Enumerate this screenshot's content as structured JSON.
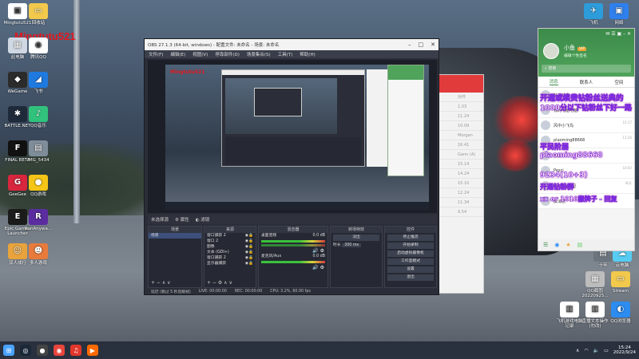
{
  "desktop": {
    "watermark": "Mingtutu521",
    "icons": [
      {
        "label": "Mingtutu521",
        "glyph": "▣",
        "color": "#ffffff"
      },
      {
        "label": "回收站",
        "glyph": "▭",
        "color": "#f2c94c"
      },
      {
        "label": "此电脑",
        "glyph": "▦",
        "color": "#cfd8e3"
      },
      {
        "label": "腾讯QQ",
        "glyph": "◉",
        "color": "#ffffff"
      },
      {
        "label": "WeGame",
        "glyph": "◆",
        "color": "#2b2b2b"
      },
      {
        "label": "飞书",
        "glyph": "◢",
        "color": "#1f7ae0"
      },
      {
        "label": "BATTLE.NET",
        "glyph": "✱",
        "color": "#1e2a3a"
      },
      {
        "label": "QQ音乐",
        "glyph": "♪",
        "color": "#31c27c"
      },
      {
        "label": "FINAL BETA",
        "glyph": "F",
        "color": "#111111"
      },
      {
        "label": "IMG_5434",
        "glyph": "▤",
        "color": "#7f8c99"
      },
      {
        "label": "GeeGee",
        "glyph": "G",
        "color": "#d7263d"
      },
      {
        "label": "QQ游戏",
        "glyph": "●",
        "color": "#f5c518"
      },
      {
        "label": "Epic Games Launcher",
        "glyph": "E",
        "color": "#1b1b1b"
      },
      {
        "label": "RunAnywa...",
        "glyph": "R",
        "color": "#5b2ca0"
      },
      {
        "label": "双人成行",
        "glyph": "☺",
        "color": "#e8a33c"
      },
      {
        "label": "多人游戏",
        "glyph": "☻",
        "color": "#e87b3c"
      }
    ],
    "right_icons": [
      {
        "label": "飞机",
        "glyph": "✈",
        "color": "#2d9cdb"
      },
      {
        "label": "网络",
        "glyph": "▣",
        "color": "#2f80ed"
      },
      {
        "label": "十年",
        "glyph": "▤",
        "color": "#6c757d"
      },
      {
        "label": "云电脑",
        "glyph": "☁",
        "color": "#56ccf2"
      },
      {
        "label": "QQ截图 20220925...",
        "glyph": "▦",
        "color": "#bdbdbd"
      },
      {
        "label": "Stream",
        "glyph": "▭",
        "color": "#f2c94c"
      },
      {
        "label": "飞机游戏电脑记录",
        "glyph": "▥",
        "color": "#ffffff"
      },
      {
        "label": "直播文本操作(勿改)",
        "glyph": "▥",
        "color": "#ffffff"
      },
      {
        "label": "QQ浏览器",
        "glyph": "◐",
        "color": "#2d8cf0"
      }
    ]
  },
  "obs": {
    "title": "OBS 27.1.3 (64-bit, windows) - 配置文件: 未命名 - 场景: 未命名",
    "menu": [
      "文件(F)",
      "编辑(E)",
      "视图(V)",
      "停靠部件(D)",
      "场景集合(S)",
      "工具(T)",
      "帮助(H)"
    ],
    "preview_label": "Mingtutu521",
    "scene_bar": {
      "label": "未选择源",
      "props": "属性",
      "filters": "滤镜"
    },
    "docks": {
      "scenes": {
        "title": "场景",
        "items": [
          "场景"
        ]
      },
      "sources": {
        "title": "来源",
        "items": [
          "窗口捕获 2",
          "窗口 2",
          "图像",
          "文本 (GDI+)",
          "窗口捕获 2",
          "显示器捕获"
        ]
      },
      "mixer": {
        "title": "混音器",
        "channels": [
          {
            "name": "桌面音频",
            "db": "0.0 dB"
          },
          {
            "name": "麦克风/Aux",
            "db": "0.0 dB"
          }
        ]
      },
      "transitions": {
        "title": "转场特效",
        "mode": "淡出",
        "duration_label": "时长",
        "duration": "300 ms"
      },
      "controls": {
        "title": "控件",
        "buttons": [
          "停止推流",
          "开始录制",
          "启动虚拟摄像机",
          "工作室模式",
          "设置",
          "退出"
        ]
      }
    },
    "status": {
      "live": "LIVE: 00:00:00",
      "rec": "REC: 00:00:00",
      "cpu": "CPU: 3.2%, 60.00 fps",
      "stream": "延迟 (跳过 5 秒后跳帧)"
    }
  },
  "redwin": {
    "rows": [
      "对件",
      "1.03",
      "11.24",
      "10.09",
      "Morgan",
      "16.41",
      "Gann (A)",
      "15.14",
      "14.24",
      "15.10",
      "12.24",
      "11.34",
      "9.54"
    ]
  },
  "qq": {
    "name": "小鱼",
    "vip": "VIP",
    "signature": "编辑个性签名",
    "search": "搜索",
    "tabs": [
      "消息",
      "联系人",
      "空间"
    ],
    "items": [
      {
        "name": "好友动态",
        "sub": "",
        "time": ""
      },
      {
        "name": "我的电脑电脑",
        "sub": "",
        "time": "15:22"
      },
      {
        "name": "风中小飞鸟",
        "sub": "",
        "time": "15:17"
      },
      {
        "name": "plaoming88668",
        "sub": "",
        "time": "11:26"
      },
      {
        "name": "群聊",
        "sub": "",
        "time": ""
      },
      {
        "name": "Pesci",
        "sub": "",
        "time": "10:02"
      },
      {
        "name": "Rooney托尼",
        "sub": "",
        "time": "昨天"
      },
      {
        "name": "群消息",
        "sub": "",
        "time": ""
      }
    ],
    "overlay": [
      "开通或续费钻粉丝送典的",
      "1000分以下钻粉丝下好一路",
      "平民阶层",
      "plaoming88668",
      "9234(10+3)",
      "开通钻粉群",
      "xx or 1010搬牌子 - 回复"
    ]
  },
  "taskbar": {
    "apps": [
      {
        "name": "start",
        "glyph": "⊞",
        "color": "#4aa3ff"
      },
      {
        "name": "steam",
        "glyph": "◎",
        "color": "#1b2838"
      },
      {
        "name": "obs",
        "glyph": "●",
        "color": "#444"
      },
      {
        "name": "chrome",
        "glyph": "◉",
        "color": "#e8453c"
      },
      {
        "name": "netease",
        "glyph": "♫",
        "color": "#e0362b"
      },
      {
        "name": "tencent-video",
        "glyph": "▶",
        "color": "#ff6a00"
      }
    ],
    "time": "15:24",
    "date": "2022/9/24"
  }
}
